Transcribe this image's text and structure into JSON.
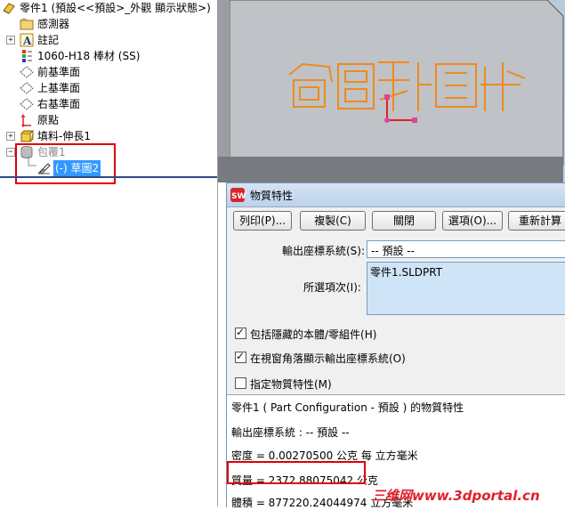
{
  "tree": {
    "items": [
      {
        "label": "零件1 (預設<<預設>_外觀 顯示狀態>)",
        "icon": "part-icon"
      },
      {
        "label": "感測器",
        "icon": "sensor-folder-icon"
      },
      {
        "label": "註記",
        "icon": "annotation-icon"
      },
      {
        "label": "1060-H18 棒材 (SS)",
        "icon": "material-icon"
      },
      {
        "label": "前基準面",
        "icon": "plane-icon"
      },
      {
        "label": "上基準面",
        "icon": "plane-icon"
      },
      {
        "label": "右基準面",
        "icon": "plane-icon"
      },
      {
        "label": "原點",
        "icon": "origin-icon"
      },
      {
        "label": "填料-伸長1",
        "icon": "extrude-icon"
      },
      {
        "label": "包覆1",
        "icon": "wrap-icon"
      },
      {
        "label": "(-) 草圖2",
        "icon": "sketch-icon"
      }
    ]
  },
  "dialog": {
    "title": "物質特性",
    "buttons": [
      "列印(P)...",
      "複製(C)",
      "關閉",
      "選項(O)...",
      "重新計算"
    ],
    "output_coord_label": "輸出座標系統(S):",
    "output_coord_value": "-- 預設 --",
    "selected_label": "所選項次(I):",
    "selected_item": "零件1.SLDPRT",
    "checkboxes": [
      {
        "label": "包括隱藏的本體/零組件(H)",
        "checked": true
      },
      {
        "label": "在視窗角落顯示輸出座標系統(O)",
        "checked": true
      },
      {
        "label": "指定物質特性(M)",
        "checked": false
      }
    ],
    "results": {
      "header": "零件1 ( Part Configuration - 預設 ) 的物質特性",
      "coord_line": "輸出座標系統 : -- 預設 --",
      "density_line": "密度 = 0.00270500 公克 每 立方毫米",
      "mass_line": "質量 = 2372.88075042 公克",
      "volume_line": "體積 = 877220.24044974 立方毫米"
    }
  },
  "viewport": {
    "wrap_text": "包覆"
  },
  "watermark": "三维网www.3dportal.cn",
  "colors": {
    "accent_red": "#e00000",
    "wrap_orange": "#f08a1c",
    "selection_blue": "#3399ff"
  }
}
